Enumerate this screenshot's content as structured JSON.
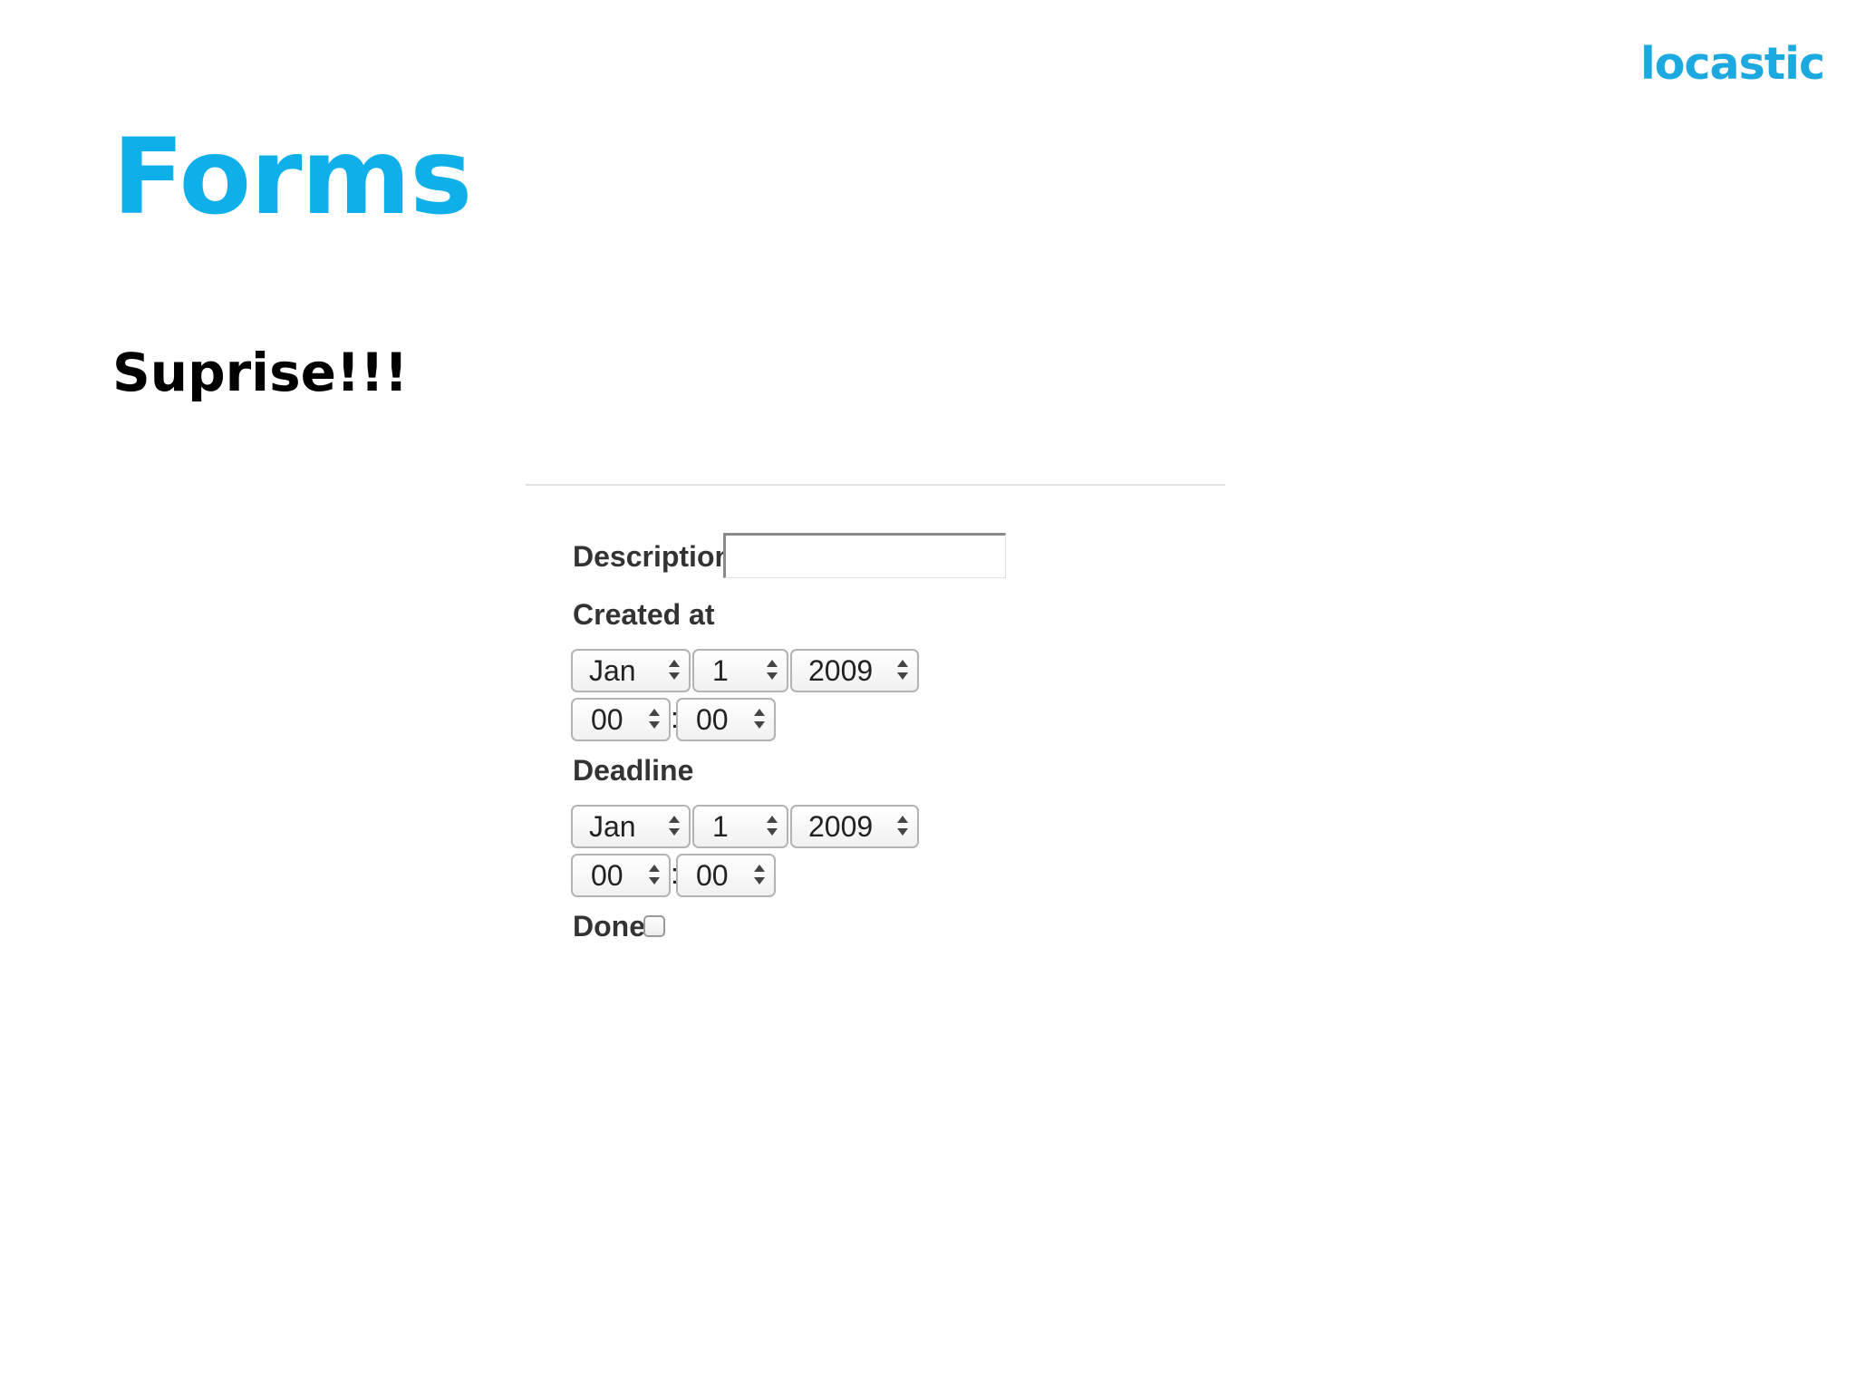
{
  "slide": {
    "brand": "locastic",
    "title": "Forms",
    "subtitle": "Suprise!!!"
  },
  "form": {
    "description": {
      "label": "Description",
      "value": ""
    },
    "created_at": {
      "label": "Created at",
      "month": "Jan",
      "day": "1",
      "year": "2009",
      "hour": "00",
      "separator": ":",
      "minute": "00"
    },
    "deadline": {
      "label": "Deadline",
      "month": "Jan",
      "day": "1",
      "year": "2009",
      "hour": "00",
      "separator": ":",
      "minute": "00"
    },
    "done": {
      "label": "Done",
      "checked": false
    }
  },
  "colors": {
    "title": "#0fb0ea",
    "brand": "#1ba9df",
    "subtitle": "#000000",
    "label": "#333333"
  }
}
